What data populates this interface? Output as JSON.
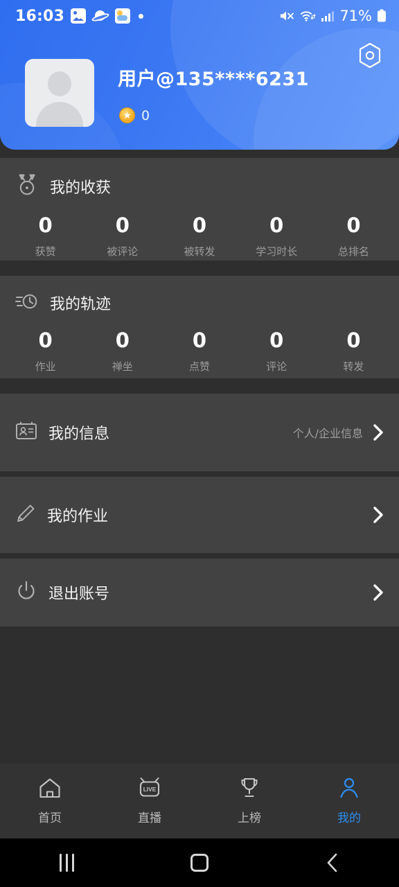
{
  "status_bar": {
    "time": "16:03",
    "battery_text": "71%",
    "icons": [
      "photos-icon",
      "saturn-icon",
      "weather-icon",
      "dot-indicator",
      "mute-icon",
      "wifi-icon",
      "signal-icon",
      "battery-icon"
    ]
  },
  "header": {
    "username": "用户@135****6231",
    "coin_count": "0",
    "avatar_alt": "default-avatar",
    "settings_icon": "settings-hex-icon",
    "accent_color": "#3b77f2"
  },
  "harvest": {
    "title": "我的收获",
    "icon": "medal-icon",
    "stats": [
      {
        "value": "0",
        "label": "获赞"
      },
      {
        "value": "0",
        "label": "被评论"
      },
      {
        "value": "0",
        "label": "被转发"
      },
      {
        "value": "0",
        "label": "学习时长"
      },
      {
        "value": "0",
        "label": "总排名"
      }
    ]
  },
  "trace": {
    "title": "我的轨迹",
    "icon": "history-clock-icon",
    "stats": [
      {
        "value": "0",
        "label": "作业"
      },
      {
        "value": "0",
        "label": "禅坐"
      },
      {
        "value": "0",
        "label": "点赞"
      },
      {
        "value": "0",
        "label": "评论"
      },
      {
        "value": "0",
        "label": "转发"
      }
    ]
  },
  "menu": [
    {
      "label": "我的信息",
      "sub": "个人/企业信息",
      "icon": "id-card-icon"
    },
    {
      "label": "我的作业",
      "sub": "",
      "icon": "pencil-icon"
    },
    {
      "label": "退出账号",
      "sub": "",
      "icon": "power-icon"
    }
  ],
  "bottom_nav": {
    "active_color": "#2b8ef0",
    "items": [
      {
        "label": "首页",
        "icon": "home-icon",
        "active": false
      },
      {
        "label": "直播",
        "icon": "live-tv-icon",
        "active": false
      },
      {
        "label": "上榜",
        "icon": "trophy-icon",
        "active": false
      },
      {
        "label": "我的",
        "icon": "person-icon",
        "active": true
      }
    ]
  },
  "android_nav": {
    "recents": "recents-icon",
    "home": "home-button-icon",
    "back": "back-icon"
  }
}
